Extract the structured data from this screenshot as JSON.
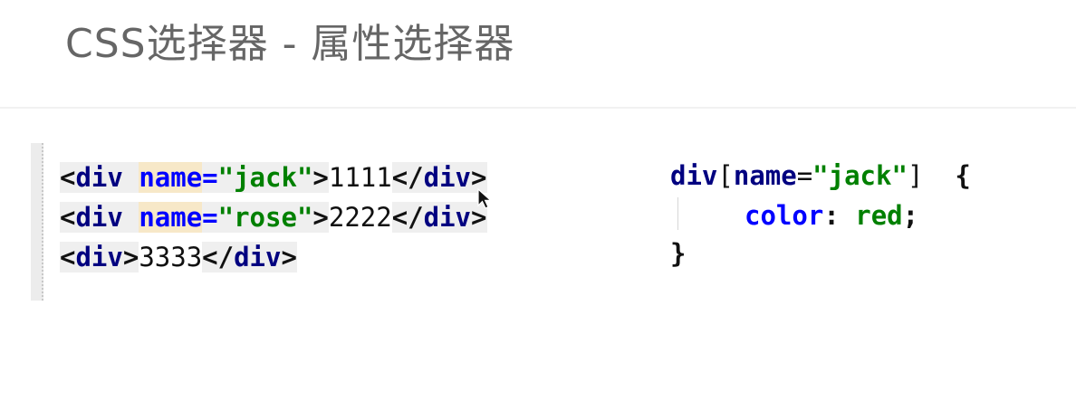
{
  "slide": {
    "title": "CSS选择器  -  属性选择器"
  },
  "html_code": {
    "lines": [
      {
        "open_lt": "<",
        "open_tag": "div",
        "space": " ",
        "attr": "name",
        "eq": "=",
        "value": "\"jack\"",
        "open_gt": ">",
        "text": "1111",
        "close_lt": "</",
        "close_tag": "div",
        "close_gt": ">"
      },
      {
        "open_lt": "<",
        "open_tag": "div",
        "space": " ",
        "attr": "name",
        "eq": "=",
        "value": "\"rose\"",
        "open_gt": ">",
        "text": "2222",
        "close_lt": "</",
        "close_tag": "div",
        "close_gt": ">"
      },
      {
        "open_lt": "<",
        "open_tag": "div",
        "open_gt": ">",
        "text": "3333",
        "close_lt": "</",
        "close_tag": "div",
        "close_gt": ">"
      }
    ]
  },
  "css_code": {
    "selector_tag": "div",
    "bracket_open": "[",
    "attr": "name",
    "eq": "=",
    "value": "\"jack\"",
    "bracket_close": "]",
    "gap": "  ",
    "brace_open": "{",
    "property": "color",
    "colon": ": ",
    "prop_value": "red",
    "semicolon": ";",
    "brace_close": "}"
  },
  "colors": {
    "tag": "#000080",
    "attribute": "#0000ff",
    "string": "#008000",
    "attr_highlight": "#f7e8c8",
    "title": "#666666"
  },
  "icons": {
    "cursor": "mouse-pointer-icon"
  }
}
